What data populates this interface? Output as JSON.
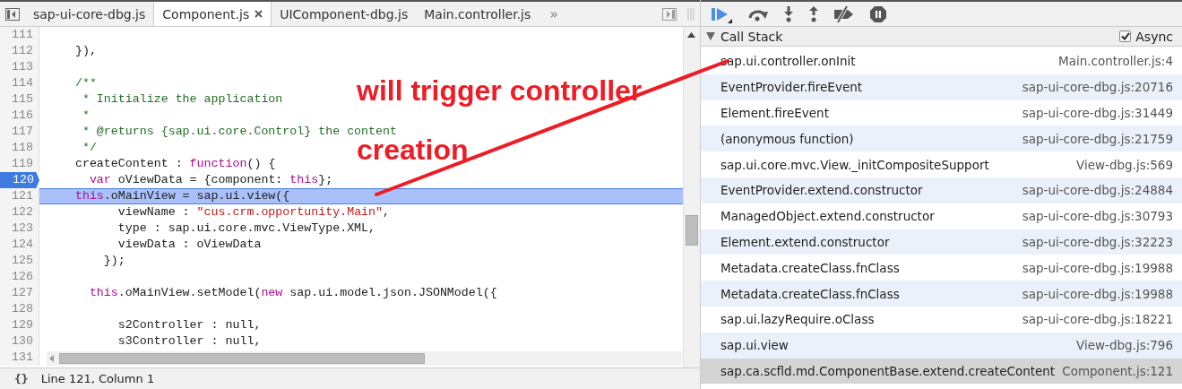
{
  "tabs": [
    {
      "label": "sap-ui-core-dbg.js",
      "selected": false,
      "closable": false
    },
    {
      "label": "Component.js",
      "selected": true,
      "closable": true
    },
    {
      "label": "UIComponent-dbg.js",
      "selected": false,
      "closable": false
    },
    {
      "label": "Main.controller.js",
      "selected": false,
      "closable": false
    }
  ],
  "more_tabs": "»",
  "code": [
    {
      "number": "111",
      "breakpoint": false,
      "current": false
    },
    {
      "number": "112",
      "breakpoint": false,
      "current": false,
      "tokens": [
        {
          "kind": "plain",
          "text": "    }),"
        }
      ]
    },
    {
      "number": "113",
      "breakpoint": false,
      "current": false
    },
    {
      "number": "114",
      "breakpoint": false,
      "current": false,
      "tokens": [
        {
          "kind": "comment",
          "text": "    /**"
        }
      ]
    },
    {
      "number": "115",
      "breakpoint": false,
      "current": false,
      "tokens": [
        {
          "kind": "comment",
          "text": "     * Initialize the application"
        }
      ]
    },
    {
      "number": "116",
      "breakpoint": false,
      "current": false,
      "tokens": [
        {
          "kind": "comment",
          "text": "     *"
        }
      ]
    },
    {
      "number": "117",
      "breakpoint": false,
      "current": false,
      "tokens": [
        {
          "kind": "comment",
          "text": "     * @returns {sap.ui.core.Control} the content"
        }
      ]
    },
    {
      "number": "118",
      "breakpoint": false,
      "current": false,
      "tokens": [
        {
          "kind": "comment",
          "text": "     */"
        }
      ]
    },
    {
      "number": "119",
      "breakpoint": false,
      "current": false,
      "tokens": [
        {
          "kind": "plain",
          "text": "    createContent : "
        },
        {
          "kind": "keyword",
          "text": "function"
        },
        {
          "kind": "plain",
          "text": "() {"
        }
      ]
    },
    {
      "number": "120",
      "breakpoint": true,
      "current": false,
      "tokens": [
        {
          "kind": "keyword",
          "text": "      var"
        },
        {
          "kind": "plain",
          "text": " oViewData = {component: "
        },
        {
          "kind": "keyword",
          "text": "this"
        },
        {
          "kind": "plain",
          "text": "};"
        }
      ]
    },
    {
      "number": "121",
      "breakpoint": false,
      "current": true,
      "tokens": [
        {
          "kind": "keyword",
          "text": "    this"
        },
        {
          "kind": "plain",
          "text": ".oMainView = sap.ui.view({"
        }
      ]
    },
    {
      "number": "122",
      "breakpoint": false,
      "current": false,
      "tokens": [
        {
          "kind": "plain",
          "text": "          viewName : "
        },
        {
          "kind": "string",
          "text": "\"cus.crm.opportunity.Main\""
        },
        {
          "kind": "plain",
          "text": ","
        }
      ]
    },
    {
      "number": "123",
      "breakpoint": false,
      "current": false,
      "tokens": [
        {
          "kind": "plain",
          "text": "          type : sap.ui.core.mvc.ViewType.XML,"
        }
      ]
    },
    {
      "number": "124",
      "breakpoint": false,
      "current": false,
      "tokens": [
        {
          "kind": "plain",
          "text": "          viewData : oViewData"
        }
      ]
    },
    {
      "number": "125",
      "breakpoint": false,
      "current": false,
      "tokens": [
        {
          "kind": "plain",
          "text": "        });"
        }
      ]
    },
    {
      "number": "126",
      "breakpoint": false,
      "current": false
    },
    {
      "number": "127",
      "breakpoint": false,
      "current": false,
      "tokens": [
        {
          "kind": "keyword",
          "text": "      this"
        },
        {
          "kind": "plain",
          "text": ".oMainView.setModel("
        },
        {
          "kind": "keyword",
          "text": "new"
        },
        {
          "kind": "plain",
          "text": " sap.ui.model.json.JSONModel({"
        }
      ]
    },
    {
      "number": "128",
      "breakpoint": false,
      "current": false
    },
    {
      "number": "129",
      "breakpoint": false,
      "current": false,
      "tokens": [
        {
          "kind": "plain",
          "text": "          s2Controller : null,"
        }
      ]
    },
    {
      "number": "130",
      "breakpoint": false,
      "current": false,
      "tokens": [
        {
          "kind": "plain",
          "text": "          s3Controller : null,"
        }
      ]
    },
    {
      "number": "131",
      "breakpoint": false,
      "current": false
    }
  ],
  "status_bar": {
    "icon_text": "{}",
    "position": "Line 121, Column 1"
  },
  "annotation": {
    "lines": [
      "will trigger controller",
      "creation"
    ]
  },
  "call_stack": {
    "title": "Call Stack",
    "expanded": true,
    "async": {
      "label": "Async",
      "checked": true
    },
    "frames": [
      {
        "function": "sap.ui.controller.onInit",
        "location": "Main.controller.js:4",
        "selected": false
      },
      {
        "function": "EventProvider.fireEvent",
        "location": "sap-ui-core-dbg.js:20716",
        "selected": false
      },
      {
        "function": "Element.fireEvent",
        "location": "sap-ui-core-dbg.js:31449",
        "selected": false
      },
      {
        "function": "(anonymous function)",
        "location": "sap-ui-core-dbg.js:21759",
        "selected": false
      },
      {
        "function": "sap.ui.core.mvc.View._initCompositeSupport",
        "location": "View-dbg.js:569",
        "selected": false
      },
      {
        "function": "EventProvider.extend.constructor",
        "location": "sap-ui-core-dbg.js:24884",
        "selected": false
      },
      {
        "function": "ManagedObject.extend.constructor",
        "location": "sap-ui-core-dbg.js:30793",
        "selected": false
      },
      {
        "function": "Element.extend.constructor",
        "location": "sap-ui-core-dbg.js:32223",
        "selected": false
      },
      {
        "function": "Metadata.createClass.fnClass",
        "location": "sap-ui-core-dbg.js:19988",
        "selected": false
      },
      {
        "function": "Metadata.createClass.fnClass",
        "location": "sap-ui-core-dbg.js:19988",
        "selected": false
      },
      {
        "function": "sap.ui.lazyRequire.oClass",
        "location": "sap-ui-core-dbg.js:18221",
        "selected": false
      },
      {
        "function": "sap.ui.view",
        "location": "View-dbg.js:796",
        "selected": false
      },
      {
        "function": "sap.ca.scfld.md.ComponentBase.extend.createContent",
        "location": "Component.js:121",
        "selected": true
      }
    ]
  }
}
